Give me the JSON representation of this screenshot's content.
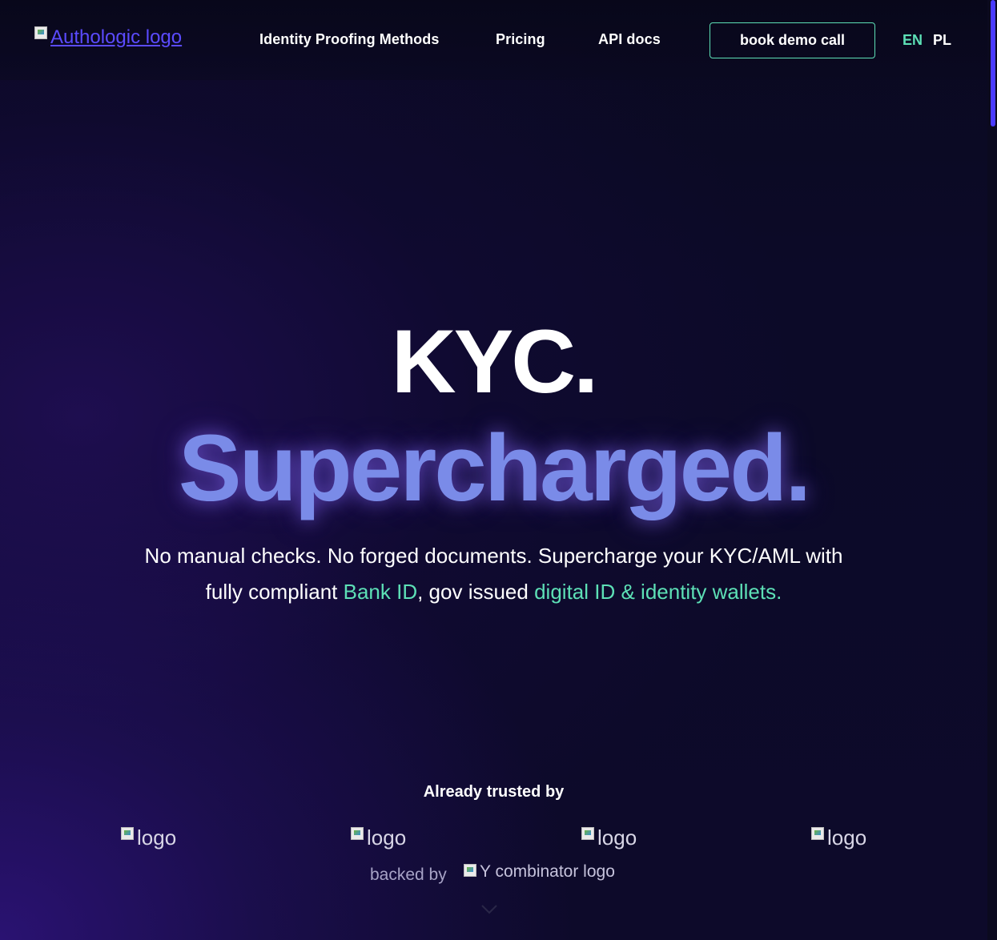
{
  "header": {
    "logo_alt": "Authologic logo",
    "nav": [
      {
        "label": "Identity Proofing Methods"
      },
      {
        "label": "Pricing"
      },
      {
        "label": "API docs"
      }
    ],
    "demo_button": "book demo call",
    "languages": {
      "en": "EN",
      "pl": "PL",
      "active": "EN"
    }
  },
  "hero": {
    "line1": "KYC.",
    "line2": "Supercharged.",
    "sub_part1": "No manual checks. No forged documents. Supercharge your KYC/AML with fully compliant ",
    "sub_link1": "Bank ID",
    "sub_part2": ", gov issued ",
    "sub_link2": "digital ID & identity wallets."
  },
  "trusted": {
    "title": "Already trusted by",
    "partners": [
      {
        "alt": "logo"
      },
      {
        "alt": "logo"
      },
      {
        "alt": "logo"
      },
      {
        "alt": "logo"
      }
    ],
    "backed_label": "backed by",
    "yc_alt": "Y combinator logo"
  },
  "colors": {
    "accent_green": "#5de0b6",
    "accent_purple": "#7a8be8",
    "background": "#0a0820",
    "scroll_thumb": "#4a3bff"
  },
  "icons": {
    "scroll_indicator": "chevron-down-icon",
    "broken_image": "broken-image-icon"
  }
}
